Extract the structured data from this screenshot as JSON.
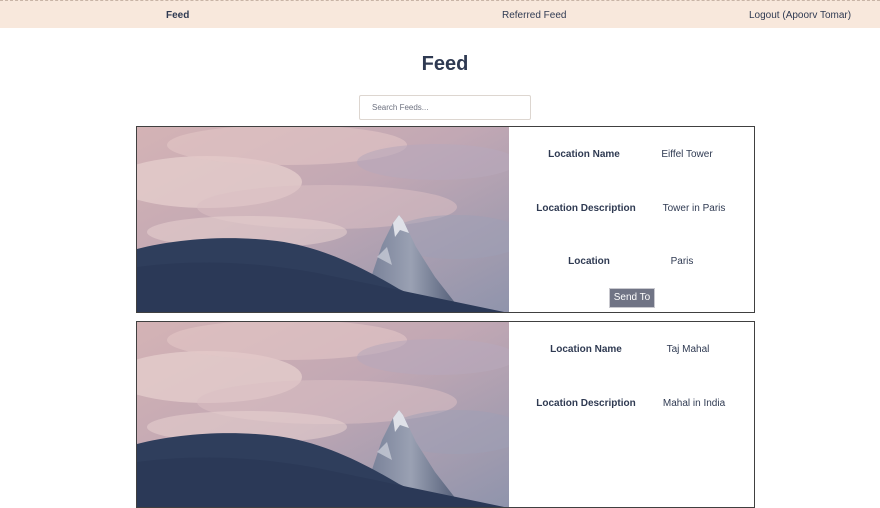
{
  "nav": {
    "feed": "Feed",
    "referred": "Referred Feed",
    "logout": "Logout (Apoorv Tomar)"
  },
  "page": {
    "title": "Feed"
  },
  "search": {
    "placeholder": "Search Feeds..."
  },
  "feeds": [
    {
      "name_label": "Location Name",
      "name": "Eiffel Tower",
      "description_label": "Location Description",
      "description": "Tower in Paris",
      "location_label": "Location",
      "location": "Paris",
      "send_label": "Send To"
    },
    {
      "name_label": "Location Name",
      "name": "Taj Mahal",
      "description_label": "Location Description",
      "description": "Mahal in India"
    }
  ],
  "colors": {
    "navbar": "#f8e8dc",
    "text": "#2f3a52",
    "button": "#707485",
    "card_border": "#404040"
  },
  "icons": {
    "card_image": "mountain-landscape-image"
  }
}
